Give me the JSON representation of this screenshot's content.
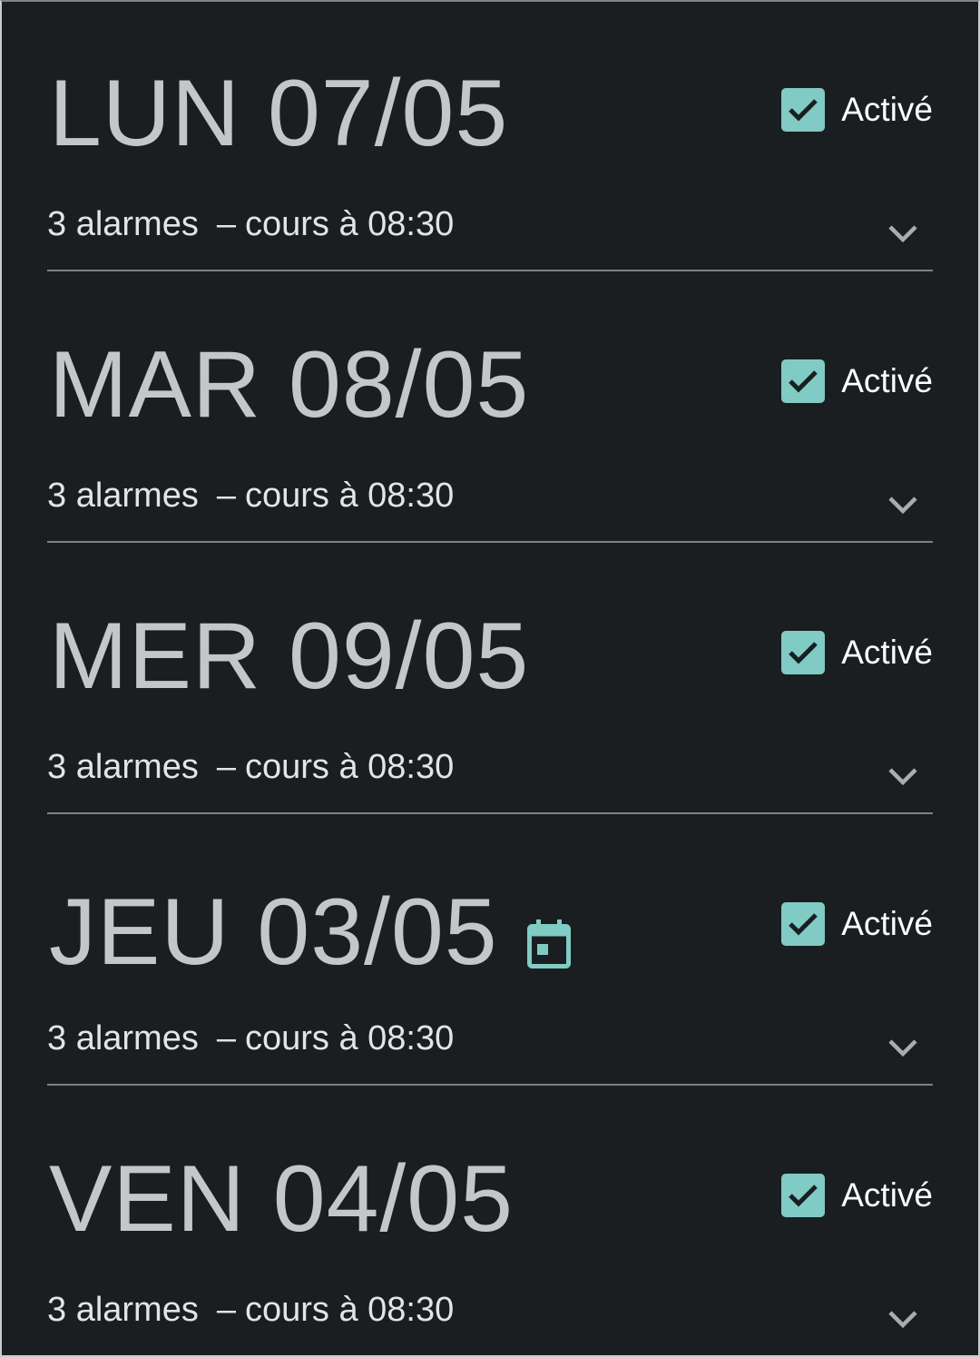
{
  "colors": {
    "background": "#1a1e21",
    "accent": "#80cbc4",
    "title_text": "#c4c7ca",
    "body_text": "#e2e4e6",
    "divider": "#7d8286"
  },
  "days": [
    {
      "title": "LUN 07/05",
      "toggle_label": "Activé",
      "checked": true,
      "alarms": "3 alarmes",
      "separator": "–",
      "course": "cours à 08:30",
      "calendar_icon": false
    },
    {
      "title": "MAR 08/05",
      "toggle_label": "Activé",
      "checked": true,
      "alarms": "3 alarmes",
      "separator": "–",
      "course": "cours à 08:30",
      "calendar_icon": false
    },
    {
      "title": "MER 09/05",
      "toggle_label": "Activé",
      "checked": true,
      "alarms": "3 alarmes",
      "separator": "–",
      "course": "cours à 08:30",
      "calendar_icon": false
    },
    {
      "title": "JEU 03/05",
      "toggle_label": "Activé",
      "checked": true,
      "alarms": "3 alarmes",
      "separator": "–",
      "course": "cours à 08:30",
      "calendar_icon": true
    },
    {
      "title": "VEN 04/05",
      "toggle_label": "Activé",
      "checked": true,
      "alarms": "3 alarmes",
      "separator": "–",
      "course": "cours à 08:30",
      "calendar_icon": false
    }
  ]
}
